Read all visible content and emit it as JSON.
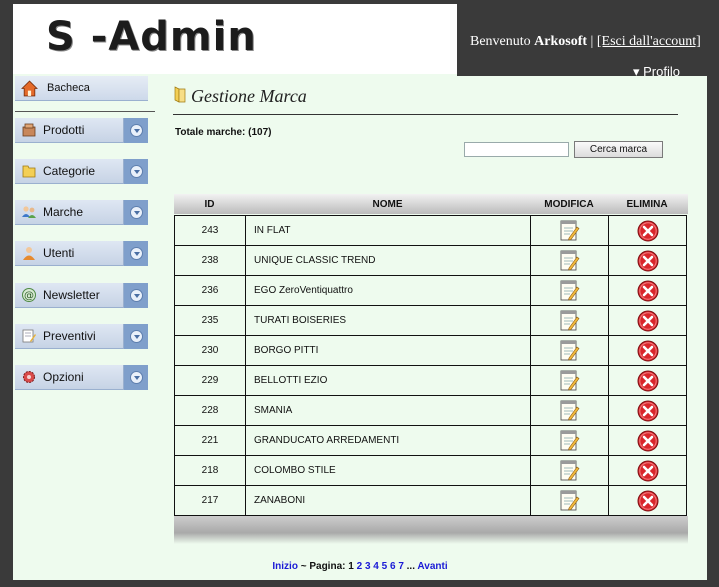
{
  "header": {
    "logo_text": "S -Admin",
    "welcome_prefix": "Benvenuto",
    "username": "Arkosoft",
    "separator": "|",
    "logout_label": "[Esci dall'account]",
    "profile_label": "▾ Profilo"
  },
  "sidebar": {
    "dashboard_label": "Bacheca",
    "items": [
      {
        "label": "Prodotti",
        "icon": "boxes-icon"
      },
      {
        "label": "Categorie",
        "icon": "folder-icon"
      },
      {
        "label": "Marche",
        "icon": "users-icon"
      },
      {
        "label": "Utenti",
        "icon": "user-icon"
      },
      {
        "label": "Newsletter",
        "icon": "at-sign-icon"
      },
      {
        "label": "Preventivi",
        "icon": "edit-icon"
      },
      {
        "label": "Opzioni",
        "icon": "gear-icon"
      }
    ]
  },
  "main": {
    "title": "Gestione Marca",
    "total_label": "Totale marche: (107)",
    "search_placeholder": "",
    "search_button": "Cerca marca"
  },
  "table": {
    "columns": {
      "id": "ID",
      "name": "NOME",
      "edit": "MODIFICA",
      "delete": "ELIMINA"
    },
    "rows": [
      {
        "id": "243",
        "name": "IN FLAT"
      },
      {
        "id": "238",
        "name": "UNIQUE CLASSIC TREND"
      },
      {
        "id": "236",
        "name": "EGO ZeroVentiquattro"
      },
      {
        "id": "235",
        "name": "TURATI BOISERIES"
      },
      {
        "id": "230",
        "name": "BORGO PITTI"
      },
      {
        "id": "229",
        "name": "BELLOTTI EZIO"
      },
      {
        "id": "228",
        "name": "SMANIA"
      },
      {
        "id": "221",
        "name": "GRANDUCATO ARREDAMENTI"
      },
      {
        "id": "218",
        "name": "COLOMBO STILE"
      },
      {
        "id": "217",
        "name": "ZANABONI"
      }
    ]
  },
  "pagination": {
    "start_label": "Inizio",
    "tilde": "~",
    "page_label": "Pagina:",
    "current": "1",
    "pages": [
      "2",
      "3",
      "4",
      "5",
      "6",
      "7"
    ],
    "ellipsis": "...",
    "next_label": "Avanti"
  },
  "colors": {
    "accent": "#7f9fcb",
    "link": "#1a1ad6",
    "background": "#eefbee",
    "header_dark": "#3a3a3a"
  }
}
